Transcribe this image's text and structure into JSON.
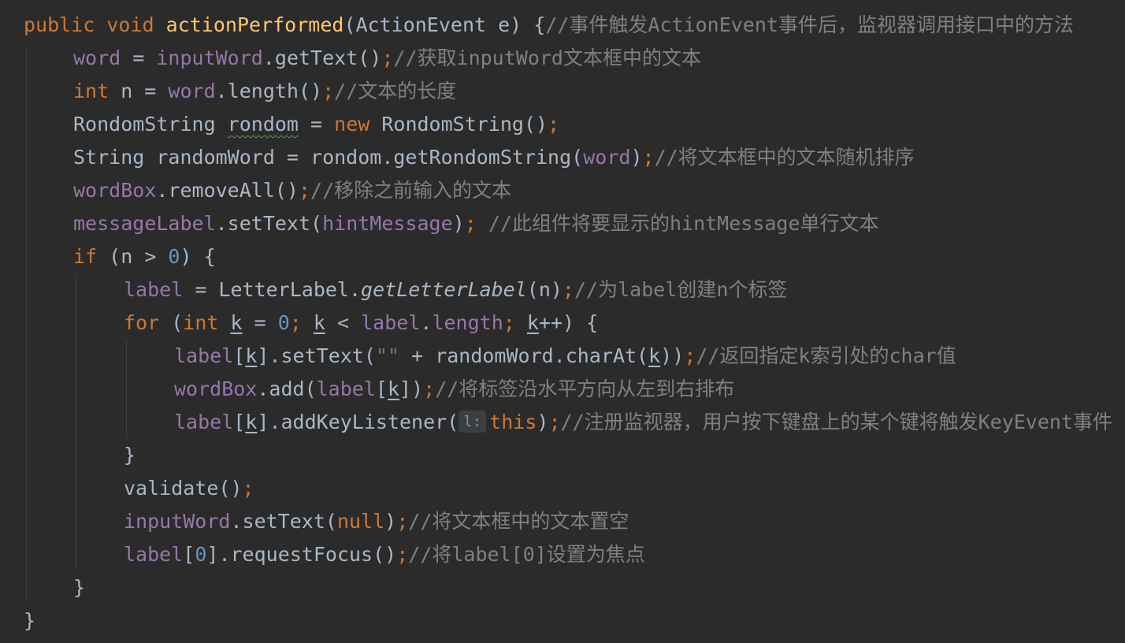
{
  "colors": {
    "background": "#2b2b2b",
    "keyword": "#cc7832",
    "method_decl": "#ffc66d",
    "field": "#9876aa",
    "number": "#6897bb",
    "string": "#6a8759",
    "comment": "#808080",
    "plain": "#a9b7c6",
    "warning_underline": "#629755"
  },
  "code_lines": [
    {
      "tokens": [
        {
          "t": "public",
          "c": "kw"
        },
        {
          "t": " "
        },
        {
          "t": "void",
          "c": "kw"
        },
        {
          "t": " "
        },
        {
          "t": "actionPerformed",
          "c": "fn"
        },
        {
          "t": "(ActionEvent e) {"
        },
        {
          "t": "//事件触发ActionEvent事件后，监视器调用接口中的方法",
          "c": "cm"
        }
      ]
    },
    {
      "tokens": [
        {
          "t": "word",
          "c": "field"
        },
        {
          "t": " = "
        },
        {
          "t": "inputWord",
          "c": "field"
        },
        {
          "t": ".getText()"
        },
        {
          "t": ";",
          "c": "kw"
        },
        {
          "t": "//获取inputWord文本框中的文本",
          "c": "cm"
        }
      ]
    },
    {
      "tokens": [
        {
          "t": "int",
          "c": "kw"
        },
        {
          "t": " n = "
        },
        {
          "t": "word",
          "c": "field"
        },
        {
          "t": ".length()"
        },
        {
          "t": ";",
          "c": "kw"
        },
        {
          "t": "//文本的长度",
          "c": "cm"
        }
      ]
    },
    {
      "tokens": [
        {
          "t": "RondomString "
        },
        {
          "t": "rondom",
          "c": "plain",
          "deco": "wavy"
        },
        {
          "t": " = "
        },
        {
          "t": "new",
          "c": "kw"
        },
        {
          "t": " RondomString()"
        },
        {
          "t": ";",
          "c": "kw"
        }
      ]
    },
    {
      "tokens": [
        {
          "t": "String randomWord = rondom.getRondomString("
        },
        {
          "t": "word",
          "c": "field"
        },
        {
          "t": ")"
        },
        {
          "t": ";",
          "c": "kw"
        },
        {
          "t": "//将文本框中的文本随机排序",
          "c": "cm"
        }
      ]
    },
    {
      "tokens": [
        {
          "t": "wordBox",
          "c": "field"
        },
        {
          "t": ".removeAll()"
        },
        {
          "t": ";",
          "c": "kw"
        },
        {
          "t": "//移除之前输入的文本",
          "c": "cm"
        }
      ]
    },
    {
      "tokens": [
        {
          "t": "messageLabel",
          "c": "field"
        },
        {
          "t": ".setText("
        },
        {
          "t": "hintMessage",
          "c": "field"
        },
        {
          "t": ")"
        },
        {
          "t": ";",
          "c": "kw"
        },
        {
          "t": " "
        },
        {
          "t": "//此组件将要显示的hintMessage单行文本",
          "c": "cm"
        }
      ]
    },
    {
      "tokens": [
        {
          "t": "if",
          "c": "kw"
        },
        {
          "t": " (n > "
        },
        {
          "t": "0",
          "c": "num"
        },
        {
          "t": ") {"
        }
      ]
    },
    {
      "tokens": [
        {
          "t": "label",
          "c": "field"
        },
        {
          "t": " = LetterLabel."
        },
        {
          "t": "getLetterLabel",
          "c": "plain",
          "deco": "italic"
        },
        {
          "t": "(n)"
        },
        {
          "t": ";",
          "c": "kw"
        },
        {
          "t": "//为label创建n个标签",
          "c": "cm"
        }
      ]
    },
    {
      "tokens": [
        {
          "t": "for",
          "c": "kw"
        },
        {
          "t": " ("
        },
        {
          "t": "int",
          "c": "kw"
        },
        {
          "t": " "
        },
        {
          "t": "k",
          "c": "plain",
          "deco": "under"
        },
        {
          "t": " = "
        },
        {
          "t": "0",
          "c": "num"
        },
        {
          "t": ";",
          "c": "kw"
        },
        {
          "t": " "
        },
        {
          "t": "k",
          "c": "plain",
          "deco": "under"
        },
        {
          "t": " < "
        },
        {
          "t": "label",
          "c": "field"
        },
        {
          "t": "."
        },
        {
          "t": "length",
          "c": "field"
        },
        {
          "t": ";",
          "c": "kw"
        },
        {
          "t": " "
        },
        {
          "t": "k",
          "c": "plain",
          "deco": "under"
        },
        {
          "t": "++) {"
        }
      ]
    },
    {
      "tokens": [
        {
          "t": "label",
          "c": "field"
        },
        {
          "t": "["
        },
        {
          "t": "k",
          "c": "plain",
          "deco": "under"
        },
        {
          "t": "].setText("
        },
        {
          "t": "\"\"",
          "c": "str"
        },
        {
          "t": " + randomWord.charAt("
        },
        {
          "t": "k",
          "c": "plain",
          "deco": "under"
        },
        {
          "t": "))"
        },
        {
          "t": ";",
          "c": "kw"
        },
        {
          "t": "//返回指定k索引处的char值",
          "c": "cm"
        }
      ]
    },
    {
      "tokens": [
        {
          "t": "wordBox",
          "c": "field"
        },
        {
          "t": ".add("
        },
        {
          "t": "label",
          "c": "field"
        },
        {
          "t": "["
        },
        {
          "t": "k",
          "c": "plain",
          "deco": "under"
        },
        {
          "t": "])"
        },
        {
          "t": ";",
          "c": "kw"
        },
        {
          "t": "//将标签沿水平方向从左到右排布",
          "c": "cm"
        }
      ]
    },
    {
      "tokens": [
        {
          "t": "label",
          "c": "field"
        },
        {
          "t": "["
        },
        {
          "t": "k",
          "c": "plain",
          "deco": "under"
        },
        {
          "t": "].addKeyListener("
        },
        {
          "t": "l:",
          "c": "hint"
        },
        {
          "t": "this",
          "c": "kw"
        },
        {
          "t": ")"
        },
        {
          "t": ";",
          "c": "kw"
        },
        {
          "t": "//注册监视器，用户按下键盘上的某个键将触发KeyEvent事件",
          "c": "cm"
        }
      ]
    },
    {
      "tokens": [
        {
          "t": "}"
        }
      ]
    },
    {
      "tokens": [
        {
          "t": "validate()"
        },
        {
          "t": ";",
          "c": "kw"
        }
      ]
    },
    {
      "tokens": [
        {
          "t": "inputWord",
          "c": "field"
        },
        {
          "t": ".setText("
        },
        {
          "t": "null",
          "c": "kw"
        },
        {
          "t": ")"
        },
        {
          "t": ";",
          "c": "kw"
        },
        {
          "t": "//将文本框中的文本置空",
          "c": "cm"
        }
      ]
    },
    {
      "tokens": [
        {
          "t": "label",
          "c": "field"
        },
        {
          "t": "["
        },
        {
          "t": "0",
          "c": "num"
        },
        {
          "t": "].requestFocus()"
        },
        {
          "t": ";",
          "c": "kw"
        },
        {
          "t": "//将label[0]设置为焦点",
          "c": "cm"
        }
      ]
    },
    {
      "tokens": [
        {
          "t": "}"
        }
      ]
    },
    {
      "tokens": [
        {
          "t": "}"
        }
      ]
    }
  ]
}
